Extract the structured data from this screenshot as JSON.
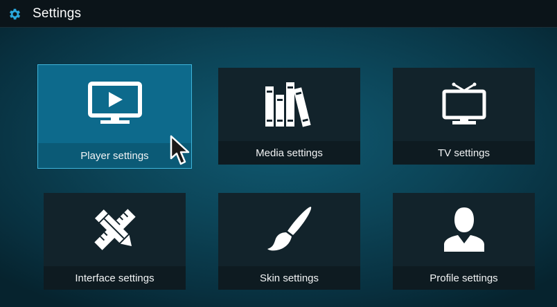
{
  "header": {
    "title": "Settings",
    "icon": "gear-icon"
  },
  "tiles": [
    {
      "label": "Player settings",
      "icon": "monitor-play-icon",
      "focused": true
    },
    {
      "label": "Media settings",
      "icon": "books-icon",
      "focused": false
    },
    {
      "label": "TV settings",
      "icon": "tv-antenna-icon",
      "focused": false
    },
    {
      "label": "Interface settings",
      "icon": "pencil-ruler-icon",
      "focused": false
    },
    {
      "label": "Skin settings",
      "icon": "paintbrush-icon",
      "focused": false
    },
    {
      "label": "Profile settings",
      "icon": "user-profile-icon",
      "focused": false
    }
  ],
  "colors": {
    "accent": "#3fb6dc",
    "focused_tile": "#0d6a8c",
    "tile": "#12232b",
    "gear": "#2aa7dc"
  }
}
